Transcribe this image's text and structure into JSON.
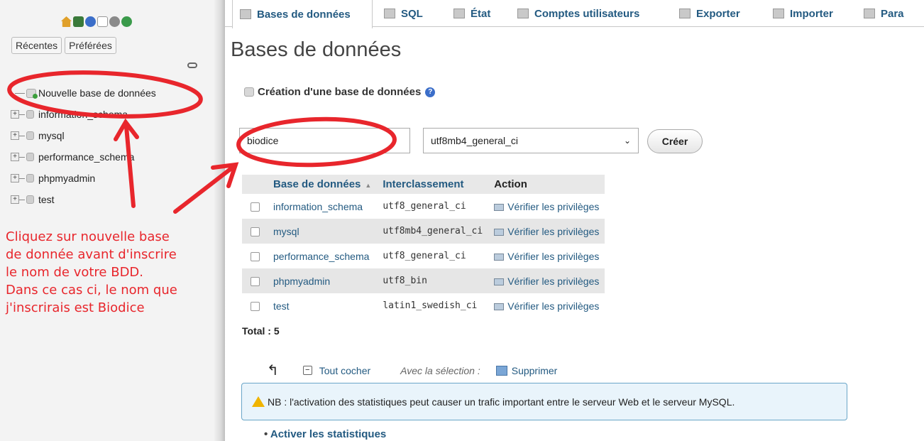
{
  "sidebar": {
    "recent_label": "Récentes",
    "favorites_label": "Préférées",
    "new_db_label": "Nouvelle base de données",
    "databases": [
      "information_schema",
      "mysql",
      "performance_schema",
      "phpmyadmin",
      "test"
    ],
    "icons": [
      "home-icon",
      "logout-icon",
      "help-icon",
      "docs-icon",
      "settings-icon",
      "reload-icon",
      "link-icon"
    ]
  },
  "annotation": {
    "note_lines": [
      "Cliquez sur nouvelle base",
      "de donnée avant d'inscrire",
      "le nom de votre BDD.",
      "Dans ce cas ci, le nom que",
      "j'inscrirais est Biodice"
    ],
    "color": "#e8262c"
  },
  "topnav": {
    "tabs": [
      "Bases de données",
      "SQL",
      "État",
      "Comptes utilisateurs",
      "Exporter",
      "Importer",
      "Para"
    ]
  },
  "main": {
    "title": "Bases de données",
    "create_section_title": "Création d'une base de données",
    "db_name_value": "biodice",
    "collation_value": "utf8mb4_general_ci",
    "create_button": "Créer",
    "table": {
      "headers": [
        "Base de données",
        "Interclassement",
        "Action"
      ],
      "rows": [
        {
          "name": "information_schema",
          "collation": "utf8_general_ci",
          "action": "Vérifier les privilèges"
        },
        {
          "name": "mysql",
          "collation": "utf8mb4_general_ci",
          "action": "Vérifier les privilèges"
        },
        {
          "name": "performance_schema",
          "collation": "utf8_general_ci",
          "action": "Vérifier les privilèges"
        },
        {
          "name": "phpmyadmin",
          "collation": "utf8_bin",
          "action": "Vérifier les privilèges"
        },
        {
          "name": "test",
          "collation": "latin1_swedish_ci",
          "action": "Vérifier les privilèges"
        }
      ]
    },
    "total": "Total : 5",
    "check_all": "Tout cocher",
    "with_selection": "Avec la sélection :",
    "delete": "Supprimer",
    "notice": "NB : l'activation des statistiques peut causer un trafic important entre le serveur Web et le serveur MySQL.",
    "enable_stats": "Activer les statistiques"
  }
}
